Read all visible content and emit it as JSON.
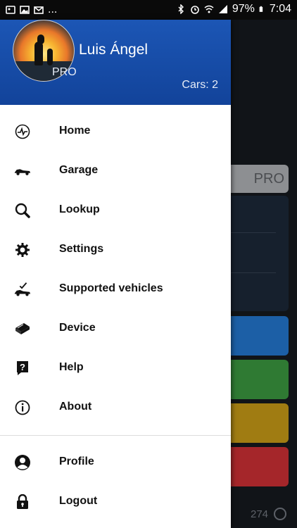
{
  "status_bar": {
    "left_icons": [
      "gallery-notification-icon",
      "image-notification-icon",
      "gmail-notification-icon"
    ],
    "more": "...",
    "battery": "97%",
    "time": "7:04"
  },
  "background_app": {
    "pro_label": "PRO",
    "counter": "274",
    "tile_colors": [
      "#1c5fa6",
      "#2f7a33",
      "#a07c12",
      "#a5262a"
    ]
  },
  "drawer": {
    "header": {
      "user_name": "Luis Ángel",
      "badge": "PRO",
      "cars": "Cars: 2",
      "bg_color": "#1c56b5"
    },
    "items": [
      {
        "label": "Home",
        "icon": "home-pulse-icon"
      },
      {
        "label": "Garage",
        "icon": "car-icon"
      },
      {
        "label": "Lookup",
        "icon": "search-icon"
      },
      {
        "label": "Settings",
        "icon": "gear-icon"
      },
      {
        "label": "Supported vehicles",
        "icon": "car-check-icon"
      },
      {
        "label": "Device",
        "icon": "obd-device-icon"
      },
      {
        "label": "Help",
        "icon": "help-icon"
      },
      {
        "label": "About",
        "icon": "info-icon"
      }
    ],
    "account_items": [
      {
        "label": "Profile",
        "icon": "profile-icon"
      },
      {
        "label": "Logout",
        "icon": "lock-icon"
      }
    ]
  }
}
